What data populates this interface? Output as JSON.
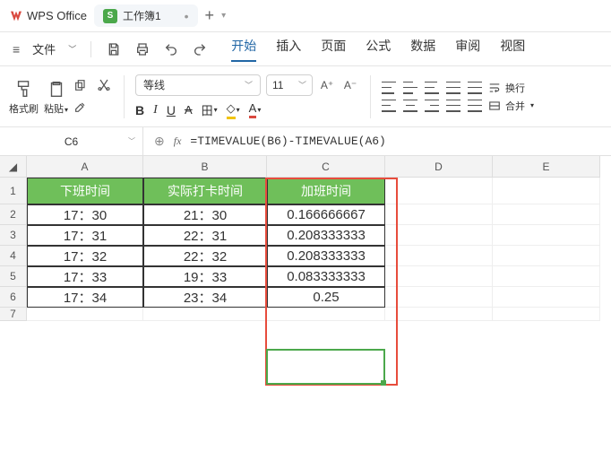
{
  "app": {
    "name": "WPS Office"
  },
  "doc": {
    "tab_badge": "S",
    "tab_name": "工作簿1",
    "plus": "+"
  },
  "menu": {
    "file": "文件",
    "items": [
      "开始",
      "插入",
      "页面",
      "公式",
      "数据",
      "审阅",
      "视图"
    ],
    "active_index": 0
  },
  "ribbon": {
    "format_painter": "格式刷",
    "paste": "粘贴",
    "font_name": "等线",
    "font_size": "11",
    "aplus": "A⁺",
    "aminus": "A⁻",
    "bold": "B",
    "italic": "I",
    "underline": "U",
    "strike": "A",
    "border_label": "田",
    "fill_label": "◇",
    "fontcolor_label": "A",
    "wrap": "换行",
    "merge": "合并"
  },
  "formula_bar": {
    "cell_ref": "C6",
    "fx": "fx",
    "formula": "=TIMEVALUE(B6)-TIMEVALUE(A6)"
  },
  "columns": [
    "A",
    "B",
    "C",
    "D",
    "E"
  ],
  "headers": [
    "下班时间",
    "实际打卡时间",
    "加班时间"
  ],
  "rows": [
    {
      "n": "1"
    },
    {
      "n": "2",
      "a": "17：30",
      "b": "21：30",
      "c": "0.166666667"
    },
    {
      "n": "3",
      "a": "17：31",
      "b": "22：31",
      "c": "0.208333333"
    },
    {
      "n": "4",
      "a": "17：32",
      "b": "22：32",
      "c": "0.208333333"
    },
    {
      "n": "5",
      "a": "17：33",
      "b": "19：33",
      "c": "0.083333333"
    },
    {
      "n": "6",
      "a": "17：34",
      "b": "23：34",
      "c": "0.25"
    },
    {
      "n": "7"
    }
  ]
}
